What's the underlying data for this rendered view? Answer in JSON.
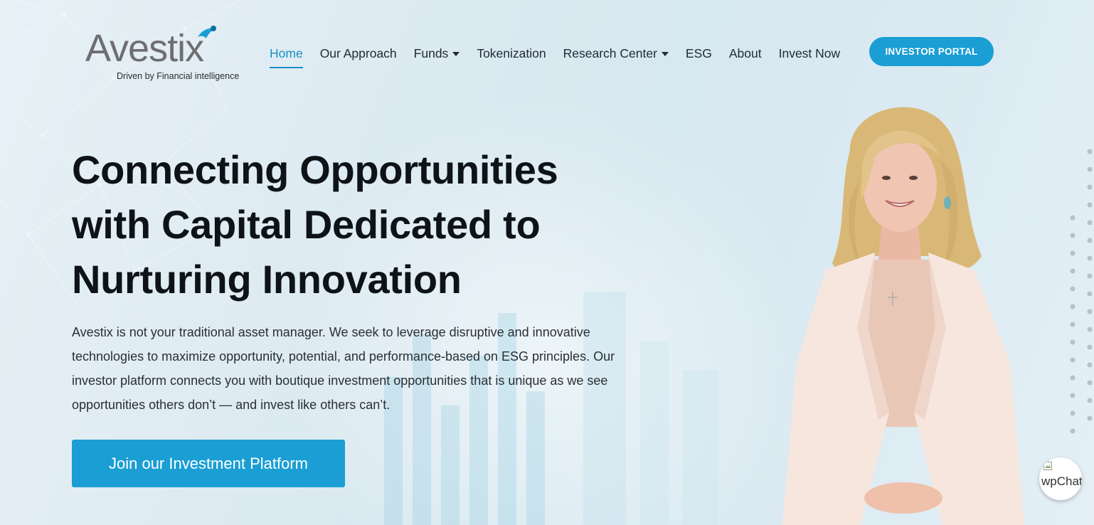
{
  "logo": {
    "word": "Avestix",
    "tagline": "Driven by Financial intelligence"
  },
  "nav": {
    "items": [
      {
        "label": "Home",
        "active": true,
        "dropdown": false
      },
      {
        "label": "Our Approach",
        "active": false,
        "dropdown": false
      },
      {
        "label": "Funds",
        "active": false,
        "dropdown": true
      },
      {
        "label": "Tokenization",
        "active": false,
        "dropdown": false
      },
      {
        "label": "Research Center",
        "active": false,
        "dropdown": true
      },
      {
        "label": "ESG",
        "active": false,
        "dropdown": false
      },
      {
        "label": "About",
        "active": false,
        "dropdown": false
      },
      {
        "label": "Invest Now",
        "active": false,
        "dropdown": false
      }
    ],
    "portal_label": "INVESTOR PORTAL"
  },
  "hero": {
    "title_lines": [
      "Connecting Opportunities",
      "with Capital Dedicated to",
      "Nurturing Innovation"
    ],
    "body": "Avestix is not your traditional asset manager. We seek to leverage disruptive and innovative technologies to maximize opportunity, potential, and performance-based on ESG principles. Our investor platform connects you with boutique investment opportunities that is unique as we see opportunities others don’t — and invest like others can’t.",
    "cta_label": "Join our Investment Platform"
  },
  "chat": {
    "alt_text": "wpChat"
  },
  "colors": {
    "accent": "#1a9ed4",
    "heading": "#0e1317",
    "logo_gray": "#6d6e71"
  }
}
